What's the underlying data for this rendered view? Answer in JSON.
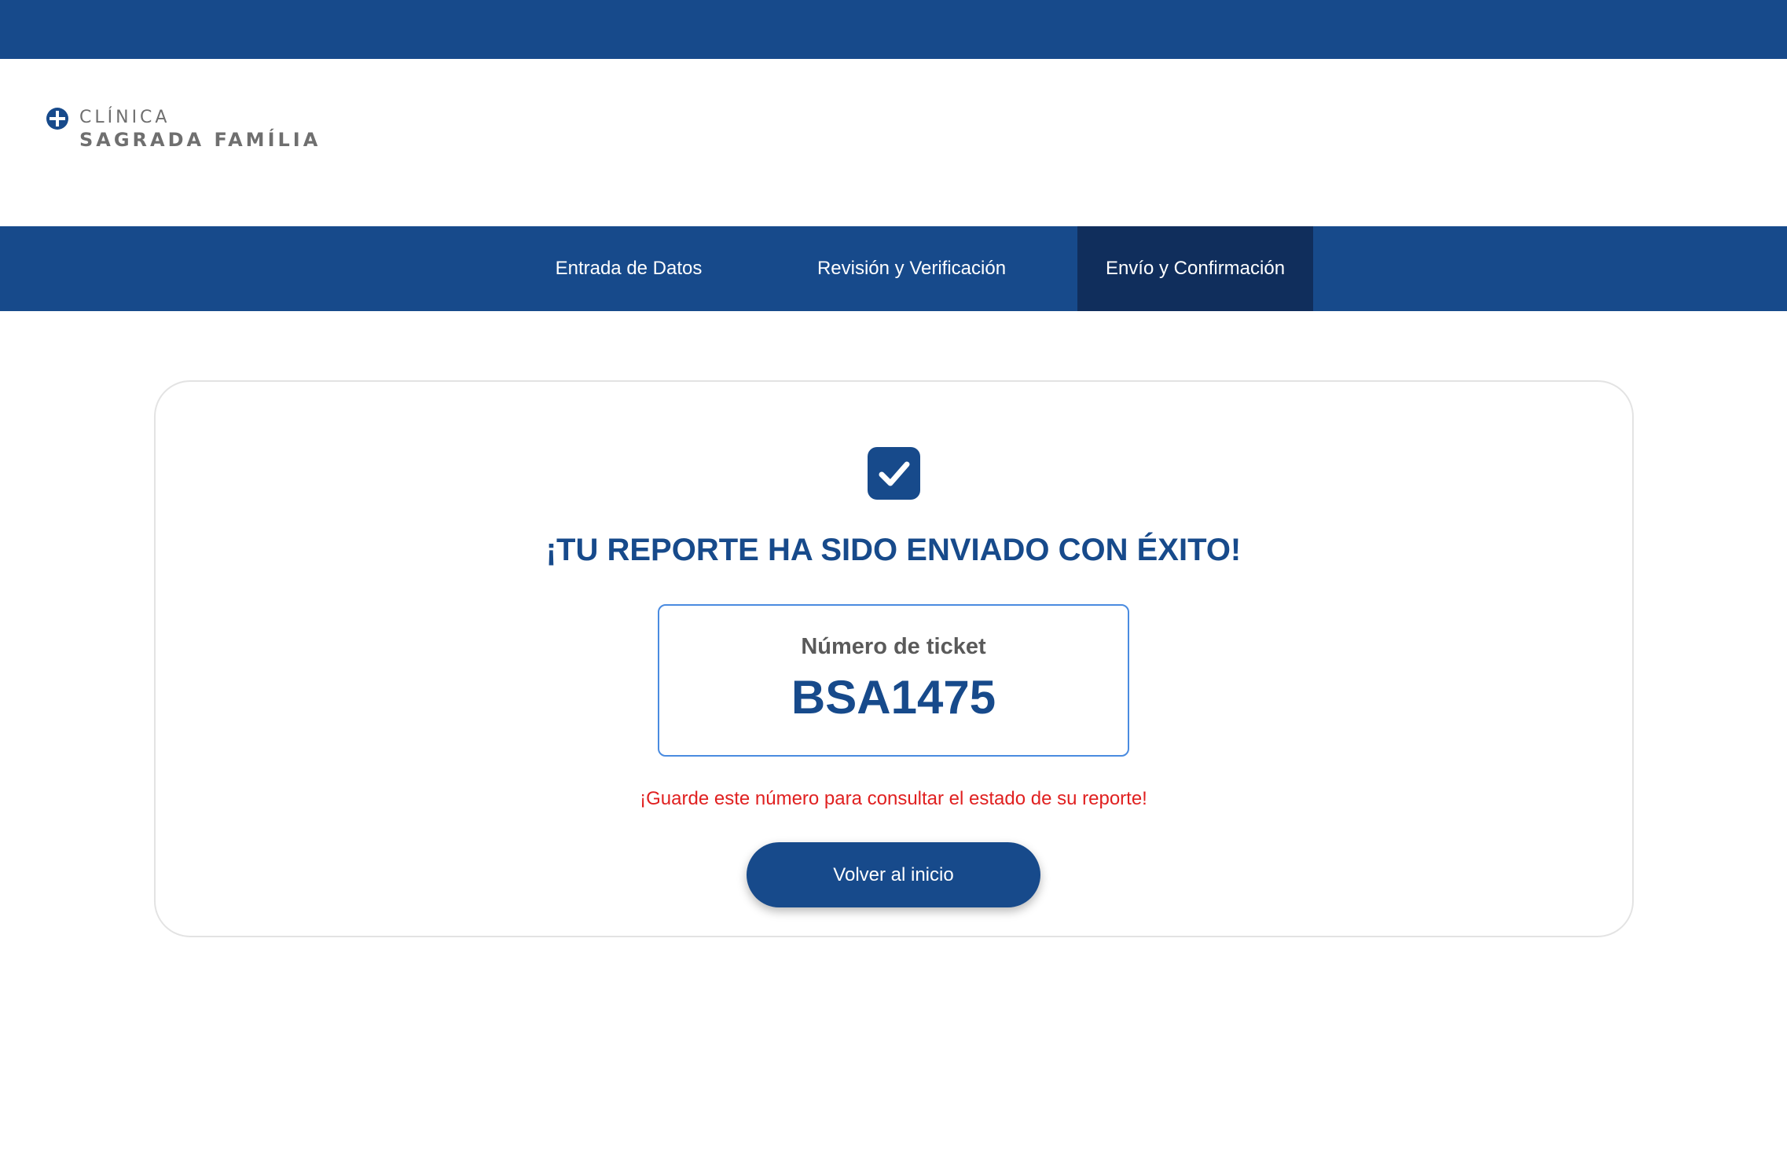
{
  "brand": {
    "line1": "CLÍNICA",
    "line2": "SAGRADA FAMÍLIA",
    "icon": "clinic-cross-icon",
    "color": "#174a8b"
  },
  "nav": {
    "items": [
      {
        "label": "Entrada de Datos",
        "active": false
      },
      {
        "label": "Revisión y Verificación",
        "active": false
      },
      {
        "label": "Envío y Confirmación",
        "active": true
      }
    ]
  },
  "confirmation": {
    "icon": "check-square-icon",
    "title": "¡TU REPORTE HA SIDO ENVIADO CON ÉXITO!",
    "ticket_label": "Número de ticket",
    "ticket_number": "BSA1475",
    "warning": "¡Guarde este número para consultar el estado de su reporte!",
    "warning_color": "#e02020",
    "button_label": "Volver al inicio"
  },
  "colors": {
    "primary": "#174a8b",
    "nav_active": "#102e5c",
    "ticket_border": "#4a8be0"
  }
}
